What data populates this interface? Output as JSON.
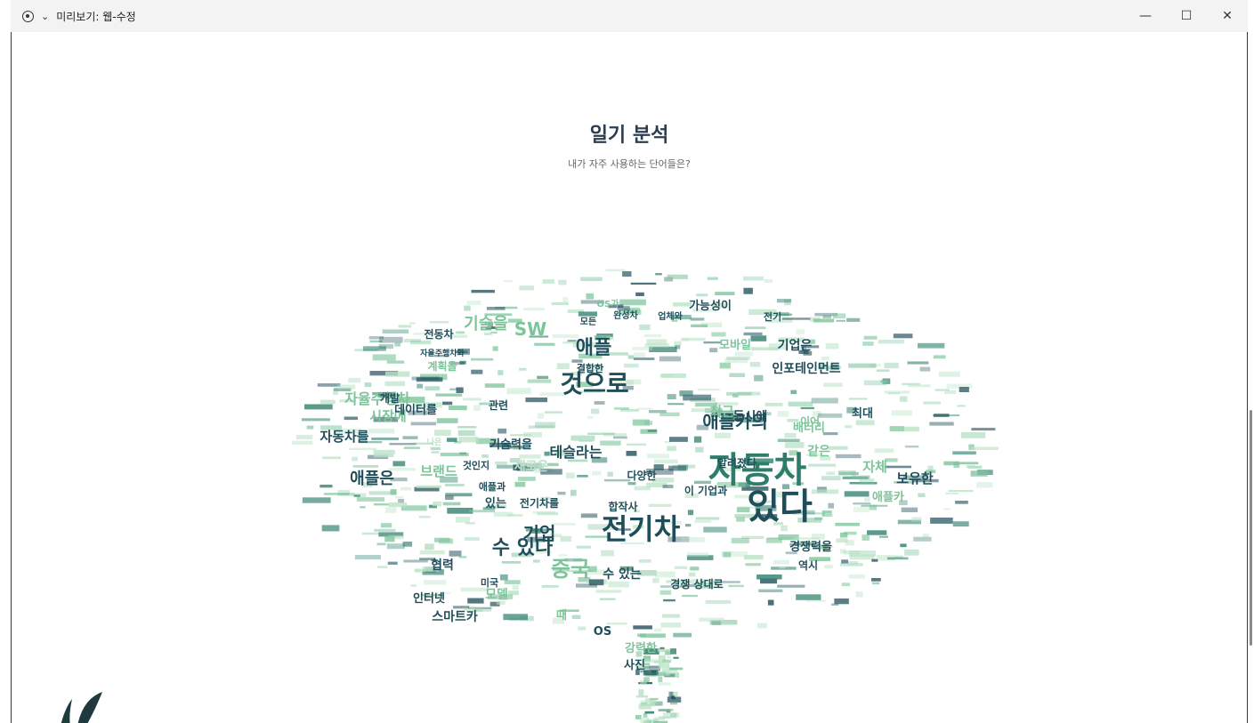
{
  "window": {
    "title": "미리보기: 웹-수정",
    "minimize": "—",
    "maximize": "☐",
    "close": "✕"
  },
  "page": {
    "heading": "일기 분석",
    "subheading": "내가 자주 사용하는 단어들은?"
  },
  "colors": {
    "dark": "#1f4e5a",
    "mid": "#2e7d6b",
    "light": "#7cc49a",
    "pale": "#b9e2c5"
  },
  "wordcloud": {
    "words": [
      {
        "text": "자동차",
        "size": 40,
        "color": "mid"
      },
      {
        "text": "있다",
        "size": 40,
        "color": "dark"
      },
      {
        "text": "전기차",
        "size": 32,
        "color": "dark"
      },
      {
        "text": "것으로",
        "size": 28,
        "color": "dark"
      },
      {
        "text": "애플카의",
        "size": 20,
        "color": "dark"
      },
      {
        "text": "애플",
        "size": 22,
        "color": "dark"
      },
      {
        "text": "SW",
        "size": 20,
        "color": "light"
      },
      {
        "text": "기술을",
        "size": 18,
        "color": "light"
      },
      {
        "text": "자율주행차",
        "size": 16,
        "color": "light"
      },
      {
        "text": "중국",
        "size": 24,
        "color": "light"
      },
      {
        "text": "수 있다",
        "size": 22,
        "color": "dark"
      },
      {
        "text": "기업",
        "size": 20,
        "color": "dark"
      },
      {
        "text": "테슬라는",
        "size": 16,
        "color": "dark"
      },
      {
        "text": "애플은",
        "size": 18,
        "color": "dark"
      },
      {
        "text": "자동차를",
        "size": 15,
        "color": "dark"
      },
      {
        "text": "시장에",
        "size": 15,
        "color": "light"
      },
      {
        "text": "데이터를",
        "size": 13,
        "color": "dark"
      },
      {
        "text": "브랜드",
        "size": 15,
        "color": "light"
      },
      {
        "text": "스마트카",
        "size": 14,
        "color": "dark"
      },
      {
        "text": "모델",
        "size": 14,
        "color": "light"
      },
      {
        "text": "인터넷",
        "size": 13,
        "color": "dark"
      },
      {
        "text": "기술력을",
        "size": 13,
        "color": "dark"
      },
      {
        "text": "최근",
        "size": 15,
        "color": "light"
      },
      {
        "text": "동시에",
        "size": 14,
        "color": "dark"
      },
      {
        "text": "인포테인먼트",
        "size": 14,
        "color": "dark"
      },
      {
        "text": "기업은",
        "size": 14,
        "color": "dark"
      },
      {
        "text": "가능성이",
        "size": 13,
        "color": "dark"
      },
      {
        "text": "모바일",
        "size": 13,
        "color": "light"
      },
      {
        "text": "배터리",
        "size": 13,
        "color": "light"
      },
      {
        "text": "자체",
        "size": 15,
        "color": "light"
      },
      {
        "text": "보유한",
        "size": 15,
        "color": "dark"
      },
      {
        "text": "애플카",
        "size": 13,
        "color": "light"
      },
      {
        "text": "경쟁력을",
        "size": 13,
        "color": "dark"
      },
      {
        "text": "역시",
        "size": 12,
        "color": "dark"
      },
      {
        "text": "새로운",
        "size": 14,
        "color": "pale"
      },
      {
        "text": "다양한",
        "size": 12,
        "color": "dark"
      },
      {
        "text": "합작사",
        "size": 12,
        "color": "dark"
      },
      {
        "text": "협력",
        "size": 14,
        "color": "dark"
      },
      {
        "text": "알려졌다",
        "size": 12,
        "color": "dark"
      },
      {
        "text": "강력한",
        "size": 13,
        "color": "light"
      },
      {
        "text": "사진",
        "size": 13,
        "color": "dark"
      },
      {
        "text": "OS",
        "size": 13,
        "color": "dark"
      },
      {
        "text": "전동차",
        "size": 12,
        "color": "dark"
      },
      {
        "text": "계획을",
        "size": 12,
        "color": "light"
      },
      {
        "text": "개발",
        "size": 12,
        "color": "dark"
      },
      {
        "text": "관련",
        "size": 12,
        "color": "dark"
      },
      {
        "text": "같은",
        "size": 14,
        "color": "light"
      },
      {
        "text": "최대",
        "size": 13,
        "color": "dark"
      },
      {
        "text": "이어",
        "size": 12,
        "color": "light"
      },
      {
        "text": "경쟁 상대로",
        "size": 12,
        "color": "dark"
      },
      {
        "text": "있는",
        "size": 13,
        "color": "dark"
      },
      {
        "text": "전기차를",
        "size": 12,
        "color": "dark"
      },
      {
        "text": "애플과",
        "size": 11,
        "color": "dark"
      },
      {
        "text": "미국",
        "size": 11,
        "color": "dark"
      },
      {
        "text": "때",
        "size": 13,
        "color": "light"
      },
      {
        "text": "수 있는",
        "size": 14,
        "color": "dark"
      },
      {
        "text": "이 기업과",
        "size": 12,
        "color": "dark"
      },
      {
        "text": "결합한",
        "size": 11,
        "color": "dark"
      },
      {
        "text": "완성차",
        "size": 10,
        "color": "dark"
      },
      {
        "text": "업체와",
        "size": 10,
        "color": "dark"
      },
      {
        "text": "모든",
        "size": 10,
        "color": "dark"
      },
      {
        "text": "전기",
        "size": 11,
        "color": "dark"
      },
      {
        "text": "것인지",
        "size": 11,
        "color": "dark"
      },
      {
        "text": "자율주행차와",
        "size": 9,
        "color": "dark"
      },
      {
        "text": "나은",
        "size": 9,
        "color": "pale"
      },
      {
        "text": "OS가",
        "size": 10,
        "color": "light"
      }
    ]
  }
}
